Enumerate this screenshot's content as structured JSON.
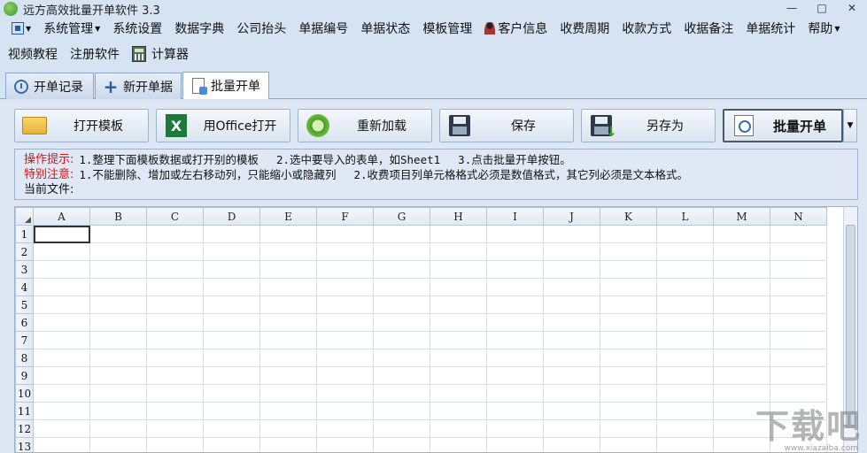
{
  "window": {
    "title": "远方高效批量开单软件 3.3",
    "controls": [
      "—",
      "□",
      "✕"
    ]
  },
  "menu": {
    "items": [
      {
        "label": "系统管理",
        "dropdown": true
      },
      {
        "label": "系统设置"
      },
      {
        "label": "数据字典"
      },
      {
        "label": "公司抬头"
      },
      {
        "label": "单据编号"
      },
      {
        "label": "单据状态"
      },
      {
        "label": "模板管理"
      },
      {
        "label": "客户信息",
        "icon": "person-icon"
      },
      {
        "label": "收费周期"
      },
      {
        "label": "收款方式"
      },
      {
        "label": "收据备注"
      },
      {
        "label": "单据统计"
      },
      {
        "label": "帮助",
        "dropdown": true
      }
    ],
    "row2": [
      {
        "label": "视频教程"
      },
      {
        "label": "注册软件"
      },
      {
        "label": "计算器",
        "icon": "calculator-icon"
      }
    ]
  },
  "tabs": [
    {
      "label": "开单记录",
      "icon": "history-icon"
    },
    {
      "label": "新开单据",
      "icon": "plus-icon"
    },
    {
      "label": "批量开单",
      "icon": "document-icon",
      "active": true
    }
  ],
  "toolbar": {
    "open_template": "打开模板",
    "open_office": "用Office打开",
    "reload": "重新加载",
    "save": "保存",
    "save_as": "另存为",
    "batch_open": "批量开单"
  },
  "hints": {
    "tip_label": "操作提示:",
    "tips": [
      "1.整理下面模板数据或打开别的模板",
      "2.选中要导入的表单，如Sheet1",
      "3.点击批量开单按钮。"
    ],
    "note_label": "特别注意:",
    "notes": [
      "1.不能删除、增加或左右移动列，只能缩小或隐藏列",
      "2.收费项目列单元格格式必须是数值格式，其它列必须是文本格式。"
    ],
    "current_file_label": "当前文件:",
    "current_file": ""
  },
  "sheet": {
    "columns": [
      "A",
      "B",
      "C",
      "D",
      "E",
      "F",
      "G",
      "H",
      "I",
      "J",
      "K",
      "L",
      "M",
      "N"
    ],
    "rows": [
      "1",
      "2",
      "3",
      "4",
      "5",
      "6",
      "7",
      "8",
      "9",
      "10",
      "11",
      "12",
      "13"
    ],
    "selected_cell": "A1"
  },
  "watermark": {
    "text": "下载吧",
    "url": "www.xiazaiba.com"
  }
}
